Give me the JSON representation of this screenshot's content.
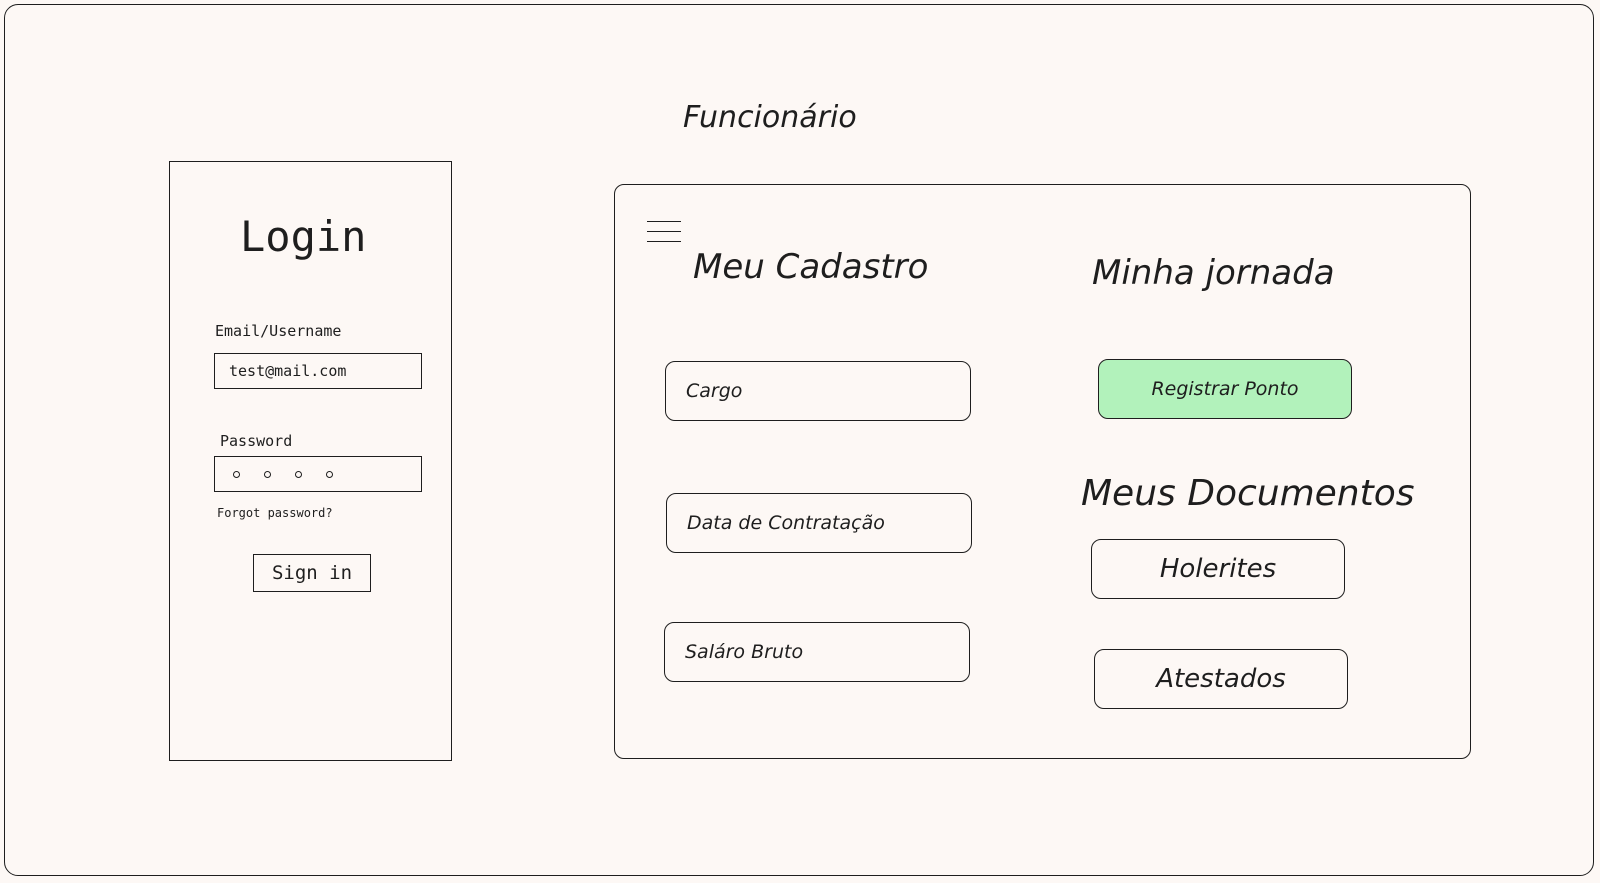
{
  "page_title": "Funcionário",
  "login": {
    "title": "Login",
    "email_label": "Email/Username",
    "email_value": "test@mail.com",
    "password_label": "Password",
    "forgot_link": "Forgot password?",
    "signin_button": "Sign in"
  },
  "panel": {
    "menu_icon": "hamburger-icon",
    "meu_cadastro": {
      "title": "Meu Cadastro",
      "fields": [
        "Cargo",
        "Data de Contratação",
        "Saláro Bruto"
      ]
    },
    "minha_jornada": {
      "title": "Minha jornada",
      "button": "Registrar Ponto"
    },
    "meus_documentos": {
      "title": "Meus Documentos",
      "items": [
        "Holerites",
        "Atestados"
      ]
    }
  },
  "colors": {
    "background": "#fdf8f5",
    "stroke": "#1e1e1e",
    "registrar_fill": "#b2f2bb"
  }
}
